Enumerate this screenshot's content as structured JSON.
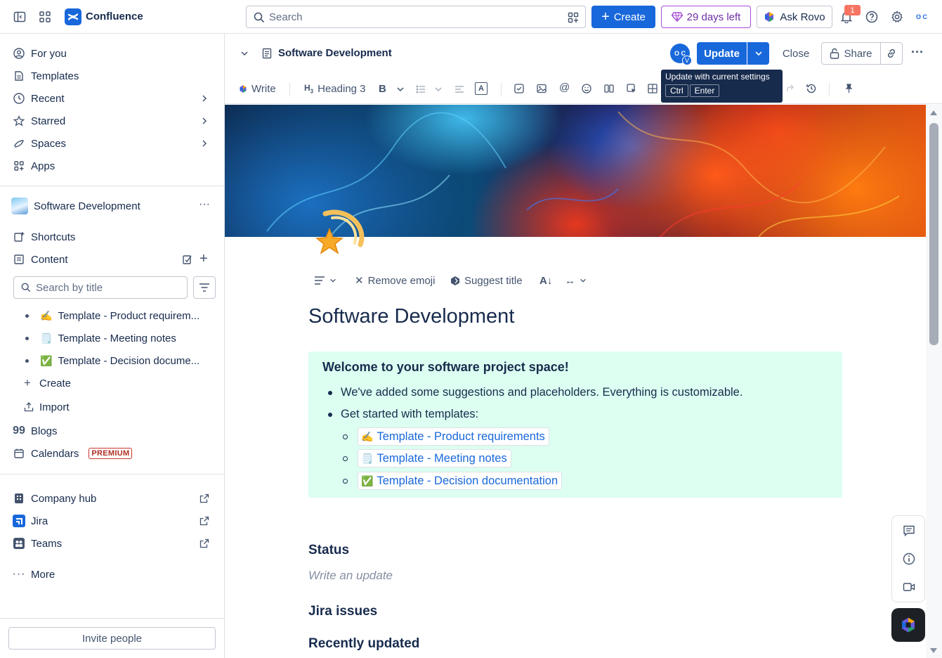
{
  "topbar": {
    "app_name": "Confluence",
    "search_placeholder": "Search",
    "create_label": "Create",
    "trial_label": "29 days left",
    "rovo_label": "Ask Rovo",
    "notification_count": "1",
    "avatar_initials": "O C"
  },
  "sidebar": {
    "nav": [
      {
        "label": "For you",
        "icon": "user-circle-icon"
      },
      {
        "label": "Templates",
        "icon": "templates-icon"
      },
      {
        "label": "Recent",
        "icon": "clock-icon"
      },
      {
        "label": "Starred",
        "icon": "star-icon"
      },
      {
        "label": "Spaces",
        "icon": "spaces-icon"
      },
      {
        "label": "Apps",
        "icon": "apps-icon"
      }
    ],
    "space_name": "Software Development",
    "space_more": "···",
    "shortcuts_label": "Shortcuts",
    "content_label": "Content",
    "search_placeholder": "Search by title",
    "tree": [
      {
        "emoji": "✍️",
        "label": "Template - Product requirem..."
      },
      {
        "emoji": "🗒️",
        "label": "Template - Meeting notes"
      },
      {
        "emoji": "✅",
        "label": "Template - Decision docume..."
      }
    ],
    "create_label": "Create",
    "import_label": "Import",
    "blogs_label": "Blogs",
    "calendars_label": "Calendars",
    "premium_badge": "PREMIUM",
    "apps": [
      {
        "label": "Company hub"
      },
      {
        "label": "Jira"
      },
      {
        "label": "Teams"
      }
    ],
    "more_label": "More",
    "invite_label": "Invite people"
  },
  "page_header": {
    "title": "Software Development",
    "avatar_initials": "O C",
    "avatar_badge": "V",
    "update_label": "Update",
    "close_label": "Close",
    "share_label": "Share",
    "tooltip": {
      "text": "Update with current settings",
      "keys": [
        "Ctrl",
        "Enter"
      ]
    }
  },
  "toolbar": {
    "write_label": "Write",
    "heading_label": "Heading 3"
  },
  "editor": {
    "mini_toolbar": {
      "remove_emoji": "Remove emoji",
      "suggest_title": "Suggest title"
    },
    "title": "Software Development",
    "panel": {
      "title": "Welcome to your software project space!",
      "bullets": [
        "We've added some suggestions and placeholders. Everything is customizable.",
        "Get started with templates:"
      ],
      "links": [
        {
          "emoji": "✍️",
          "label": "Template - Product requirements"
        },
        {
          "emoji": "🗒️",
          "label": "Template - Meeting notes"
        },
        {
          "emoji": "✅",
          "label": "Template - Decision documentation"
        }
      ]
    },
    "status_heading": "Status",
    "status_placeholder": "Write an update",
    "jira_heading": "Jira issues",
    "recent_heading": "Recently updated"
  },
  "colors": {
    "brand": "#1868db",
    "panel_bg": "#dcfff1",
    "premium": "#ae2e24"
  }
}
